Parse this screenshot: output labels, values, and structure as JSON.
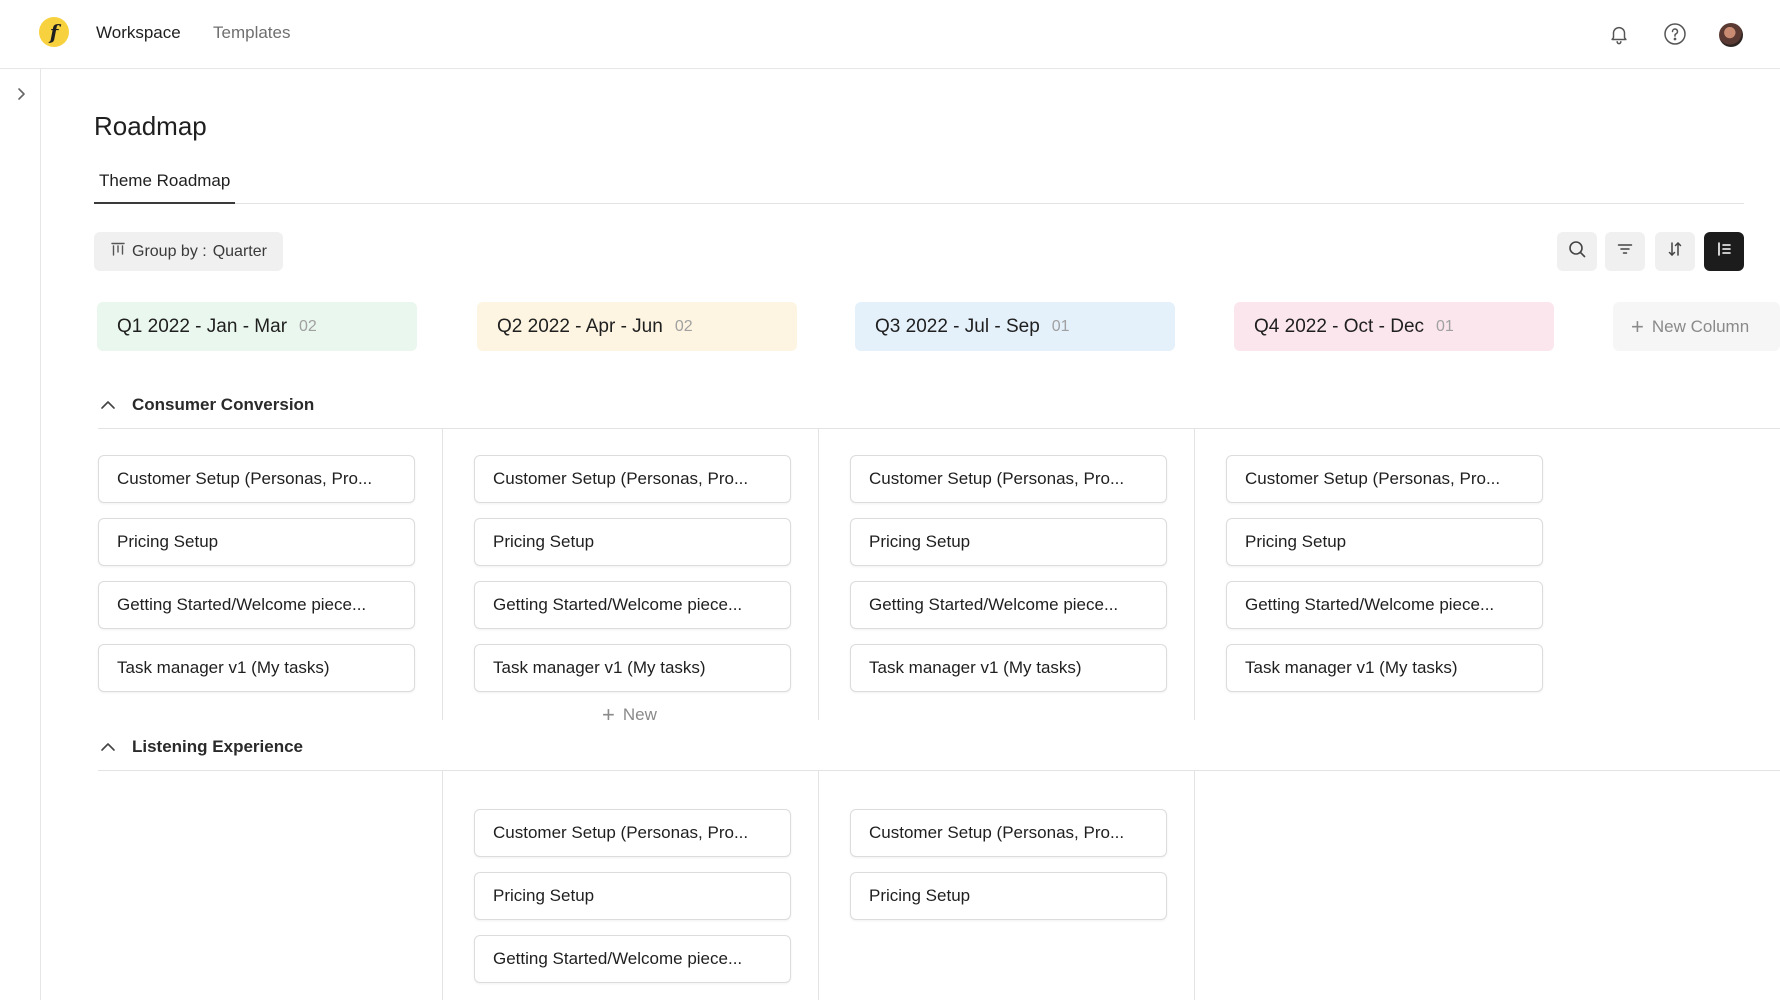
{
  "topbar": {
    "logo_letter": "f",
    "nav": [
      {
        "label": "Workspace"
      },
      {
        "label": "Templates"
      }
    ]
  },
  "page": {
    "title": "Roadmap",
    "tabs": [
      {
        "label": "Theme Roadmap"
      }
    ]
  },
  "toolbar": {
    "group_by_label": "Group by :",
    "group_by_value": "Quarter"
  },
  "columns": [
    {
      "title": "Q1 2022 - Jan - Mar",
      "count": "02",
      "color": "#eaf7ee"
    },
    {
      "title": "Q2 2022 - Apr - Jun",
      "count": "02",
      "color": "#fdf5e1"
    },
    {
      "title": "Q3 2022 - Jul - Sep",
      "count": "01",
      "color": "#e4f1fb"
    },
    {
      "title": "Q4 2022 - Oct - Dec",
      "count": "01",
      "color": "#fbe6ee"
    }
  ],
  "new_column_label": "New Column",
  "groups": [
    {
      "title": "Consumer Conversion",
      "columns": [
        {
          "cards": [
            "Customer Setup (Personas, Pro...",
            "Pricing Setup",
            "Getting Started/Welcome piece...",
            "Task manager v1 (My tasks)"
          ]
        },
        {
          "cards": [
            "Customer Setup (Personas, Pro...",
            "Pricing Setup",
            "Getting Started/Welcome piece...",
            "Task manager v1 (My tasks)"
          ],
          "new_label": "New"
        },
        {
          "cards": [
            "Customer Setup (Personas, Pro...",
            "Pricing Setup",
            "Getting Started/Welcome piece...",
            "Task manager v1 (My tasks)"
          ]
        },
        {
          "cards": [
            "Customer Setup (Personas, Pro...",
            "Pricing Setup",
            "Getting Started/Welcome piece...",
            "Task manager v1 (My tasks)"
          ]
        }
      ]
    },
    {
      "title": "Listening Experience",
      "columns": [
        {
          "cards": []
        },
        {
          "cards": [
            "Customer Setup (Personas, Pro...",
            "Pricing Setup",
            "Getting Started/Welcome piece..."
          ]
        },
        {
          "cards": [
            "Customer Setup (Personas, Pro...",
            "Pricing Setup"
          ]
        },
        {
          "cards": []
        }
      ]
    }
  ]
}
